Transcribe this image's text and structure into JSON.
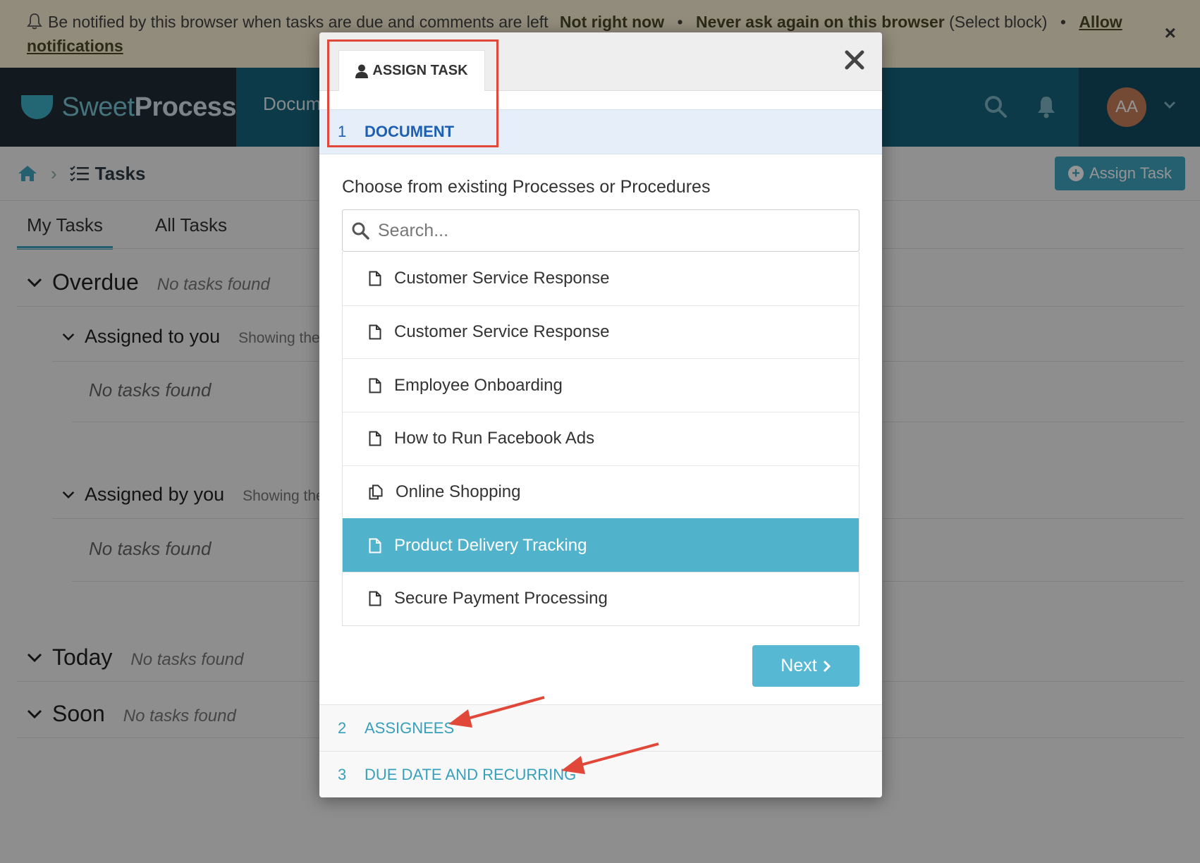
{
  "banner": {
    "message": "Be notified by this browser when tasks are due and comments are left",
    "not_now": "Not right now",
    "never_ask": "Never ask again on this browser",
    "select_block": "(Select block)",
    "allow": "Allow",
    "notifications": "notifications",
    "close": "×"
  },
  "nav": {
    "brand_light": "Sweet",
    "brand_bold": "Process",
    "documents_tab": "Docum",
    "avatar_initials": "AA"
  },
  "page": {
    "breadcrumb_title": "Tasks",
    "assign_button": "Assign Task",
    "tabs": [
      "My Tasks",
      "All Tasks"
    ],
    "sections": {
      "overdue": "Overdue",
      "today": "Today",
      "soon": "Soon",
      "assigned_to_you": "Assigned to you",
      "assigned_by_you": "Assigned by you",
      "showing": "Showing the f",
      "showing2": "Showing the f",
      "no_tasks": "No tasks found"
    }
  },
  "modal": {
    "tab_label": "ASSIGN TASK",
    "step1": {
      "num": "1",
      "label": "DOCUMENT"
    },
    "choose_label": "Choose from existing Processes or Procedures",
    "search_placeholder": "Search...",
    "items": [
      {
        "label": "Customer Service Response",
        "icon": "document-icon"
      },
      {
        "label": "Customer Service Response",
        "icon": "document-icon"
      },
      {
        "label": "Employee Onboarding",
        "icon": "document-icon"
      },
      {
        "label": "How to Run Facebook Ads",
        "icon": "document-icon"
      },
      {
        "label": "Online Shopping",
        "icon": "copy-document-icon"
      },
      {
        "label": "Product Delivery Tracking",
        "icon": "document-icon",
        "selected": true
      },
      {
        "label": "Secure Payment Processing",
        "icon": "document-icon"
      }
    ],
    "next_button": "Next",
    "step2": {
      "num": "2",
      "label": "ASSIGNEES"
    },
    "step3": {
      "num": "3",
      "label": "DUE DATE AND RECURRING"
    }
  },
  "colors": {
    "accent": "#51b2cc",
    "nav": "#16647e",
    "annotation": "#e2483a"
  }
}
